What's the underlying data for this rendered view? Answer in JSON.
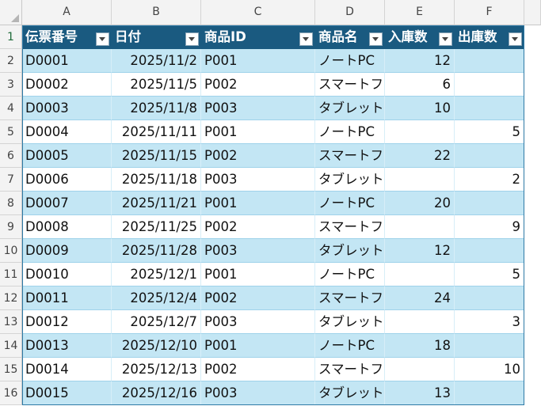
{
  "columns": [
    "A",
    "B",
    "C",
    "D",
    "E",
    "F"
  ],
  "rows": [
    "1",
    "2",
    "3",
    "4",
    "5",
    "6",
    "7",
    "8",
    "9",
    "10",
    "11",
    "12",
    "13",
    "14",
    "15",
    "16"
  ],
  "headers": [
    "伝票番号",
    "日付",
    "商品ID",
    "商品名",
    "入庫数",
    "出庫数"
  ],
  "data": [
    [
      "D0001",
      "2025/11/2",
      "P001",
      "ノートPC",
      "12",
      ""
    ],
    [
      "D0002",
      "2025/11/5",
      "P002",
      "スマートフ",
      "6",
      ""
    ],
    [
      "D0003",
      "2025/11/8",
      "P003",
      "タブレット",
      "10",
      ""
    ],
    [
      "D0004",
      "2025/11/11",
      "P001",
      "ノートPC",
      "",
      "5"
    ],
    [
      "D0005",
      "2025/11/15",
      "P002",
      "スマートフ",
      "22",
      ""
    ],
    [
      "D0006",
      "2025/11/18",
      "P003",
      "タブレット",
      "",
      "2"
    ],
    [
      "D0007",
      "2025/11/21",
      "P001",
      "ノートPC",
      "20",
      ""
    ],
    [
      "D0008",
      "2025/11/25",
      "P002",
      "スマートフォン",
      "",
      "9"
    ],
    [
      "D0009",
      "2025/11/28",
      "P003",
      "タブレット",
      "12",
      ""
    ],
    [
      "D0010",
      "2025/12/1",
      "P001",
      "ノートPC",
      "",
      "5"
    ],
    [
      "D0011",
      "2025/12/4",
      "P002",
      "スマートフ",
      "24",
      ""
    ],
    [
      "D0012",
      "2025/12/7",
      "P003",
      "タブレット",
      "",
      "3"
    ],
    [
      "D0013",
      "2025/12/10",
      "P001",
      "ノートPC",
      "18",
      ""
    ],
    [
      "D0014",
      "2025/12/13",
      "P002",
      "スマートフォン",
      "",
      "10"
    ],
    [
      "D0015",
      "2025/12/16",
      "P003",
      "タブレット",
      "13",
      ""
    ]
  ],
  "colors": {
    "header_bg": "#1a5a80",
    "band": "#c3e6f4",
    "plain": "#ffffff",
    "header_text": "#ffffff"
  }
}
